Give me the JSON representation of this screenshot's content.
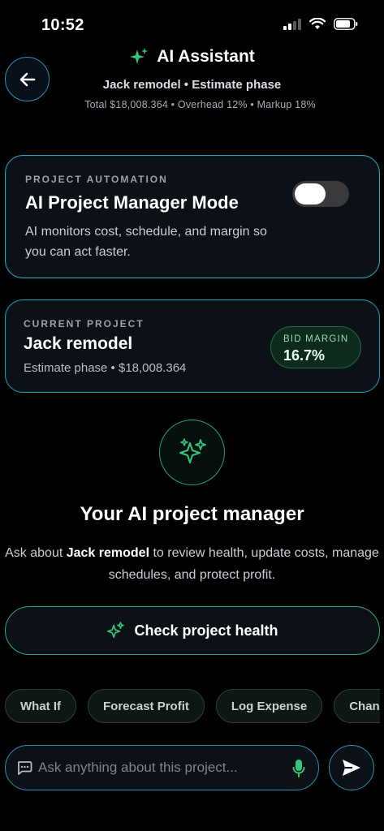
{
  "status_bar": {
    "time": "10:52"
  },
  "header": {
    "title": "AI Assistant",
    "subtitle": "Jack remodel • Estimate phase",
    "summary": "Total $18,008.364 • Overhead 12% • Markup 18%"
  },
  "automation_card": {
    "eyebrow": "PROJECT AUTOMATION",
    "title": "AI Project Manager Mode",
    "description": "AI monitors cost, schedule, and margin so you can act faster.",
    "toggle_on": false
  },
  "project_card": {
    "eyebrow": "CURRENT PROJECT",
    "title": "Jack remodel",
    "meta": "Estimate phase • $18,008.364",
    "margin_label": "BID MARGIN",
    "margin_value": "16.7%"
  },
  "hero": {
    "title": "Your AI project manager",
    "text_prefix": "Ask about ",
    "text_project": "Jack remodel",
    "text_suffix": " to review health, update costs, manage schedules, and protect profit."
  },
  "primary_action": {
    "label": "Check project health"
  },
  "chips": [
    "What If",
    "Forecast Profit",
    "Log Expense",
    "Change Order"
  ],
  "composer": {
    "placeholder": "Ask anything about this project..."
  },
  "colors": {
    "accent_blue": "#2a8fb3",
    "accent_green": "#34c77b",
    "background": "#000000"
  }
}
